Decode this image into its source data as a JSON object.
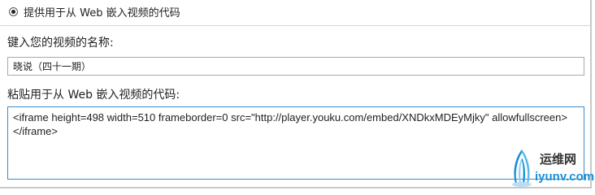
{
  "embed_option": {
    "label": "提供用于从 Web 嵌入视频的代码",
    "selected": true
  },
  "video_name": {
    "label": "键入您的视频的名称:",
    "value": "晓说（四十一期）"
  },
  "embed_code": {
    "label": "粘贴用于从 Web 嵌入视频的代码:",
    "value": "<iframe height=498 width=510 frameborder=0 src=\"http://player.youku.com/embed/XNDkxMDEyMjky\" allowfullscreen></iframe>"
  },
  "watermark": {
    "site_name_cn": "运维网",
    "site_domain": "iyunv.com",
    "colors": {
      "accent": "#1a8fd6"
    }
  },
  "colors": {
    "focus_border": "#3c8dcb",
    "input_border": "#a9a9a9"
  }
}
